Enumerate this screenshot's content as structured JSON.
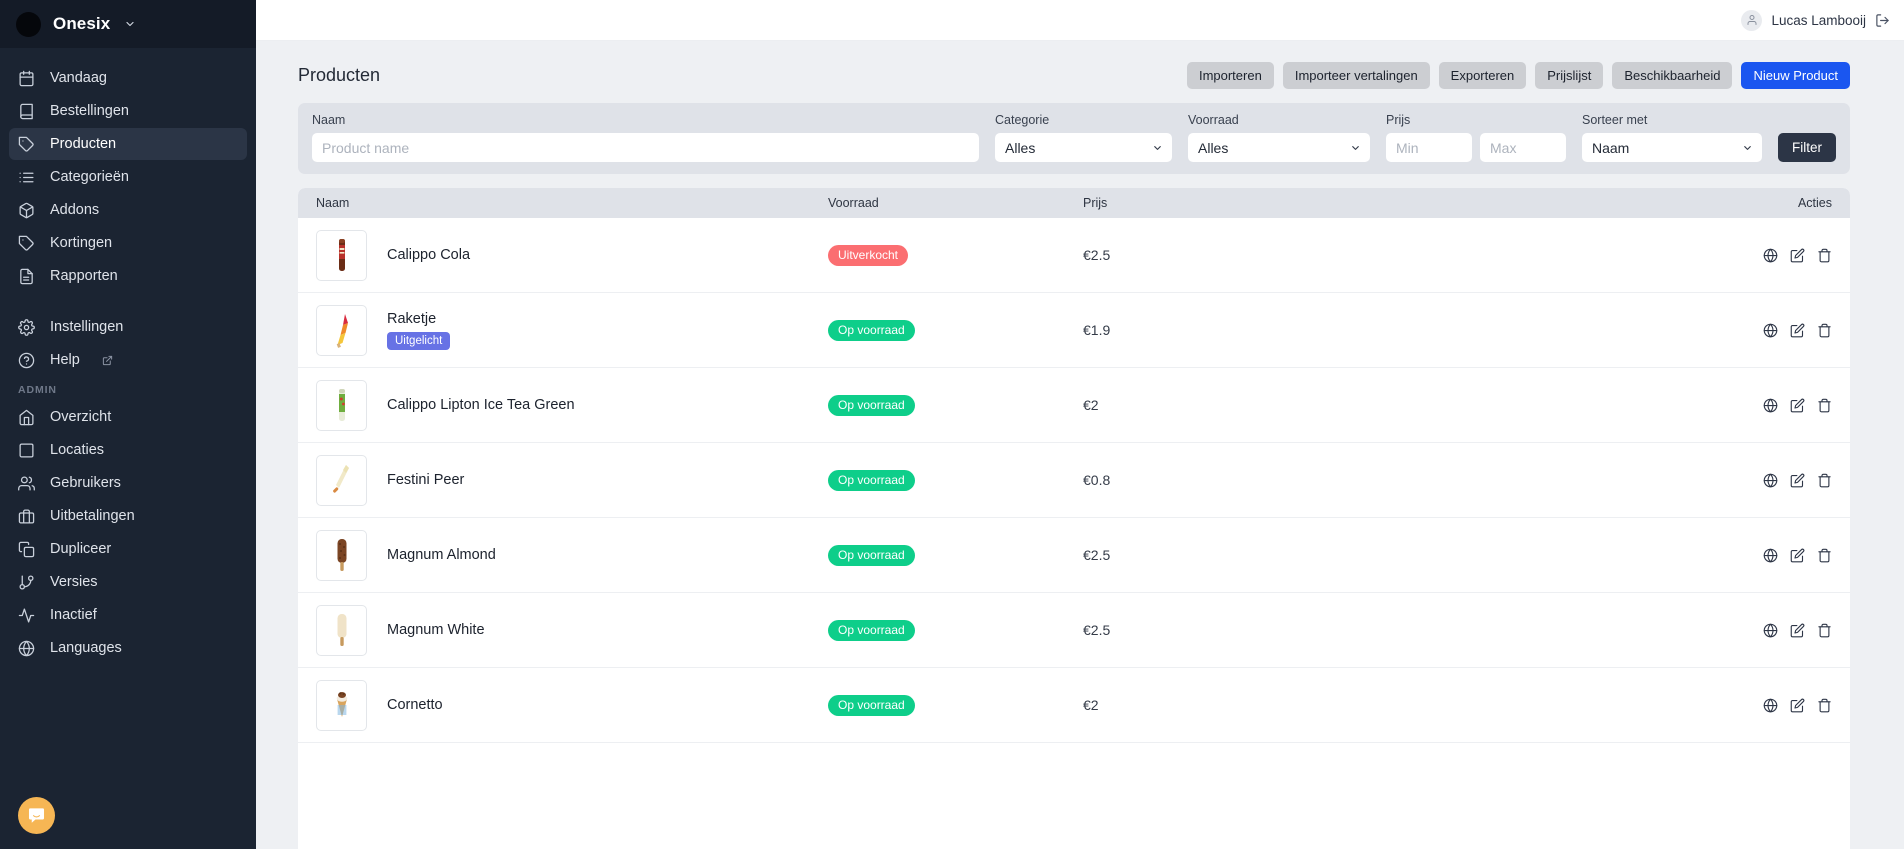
{
  "sidebar": {
    "brand": {
      "name": "Onesix",
      "logo_icon": "brand-avatar",
      "caret_icon": "chevron-down-icon"
    },
    "items": [
      {
        "label": "Vandaag",
        "icon": "calendar-icon",
        "active": false
      },
      {
        "label": "Bestellingen",
        "icon": "book-icon",
        "active": false
      },
      {
        "label": "Producten",
        "icon": "tag-icon",
        "active": true
      },
      {
        "label": "Categorieën",
        "icon": "list-icon",
        "active": false
      },
      {
        "label": "Addons",
        "icon": "box-icon",
        "active": false
      },
      {
        "label": "Kortingen",
        "icon": "tag-icon",
        "active": false
      },
      {
        "label": "Rapporten",
        "icon": "document-icon",
        "active": false
      }
    ],
    "secondary_items": [
      {
        "label": "Instellingen",
        "icon": "gear-icon",
        "active": false
      },
      {
        "label": "Help",
        "icon": "question-circle-icon",
        "active": false,
        "external": true
      }
    ],
    "admin_section_label": "ADMIN",
    "admin_items": [
      {
        "label": "Overzicht",
        "icon": "home-icon"
      },
      {
        "label": "Locaties",
        "icon": "square-icon"
      },
      {
        "label": "Gebruikers",
        "icon": "users-icon"
      },
      {
        "label": "Uitbetalingen",
        "icon": "briefcase-icon"
      },
      {
        "label": "Dupliceer",
        "icon": "copy-icon"
      },
      {
        "label": "Versies",
        "icon": "branch-icon"
      },
      {
        "label": "Inactief",
        "icon": "activity-icon"
      },
      {
        "label": "Languages",
        "icon": "globe-icon"
      }
    ],
    "chat_widget": {
      "icon": "chat-bubble-icon",
      "color": "#f6b654"
    }
  },
  "topbar": {
    "user_name": "Lucas Lambooij",
    "avatar_icon": "user-icon",
    "logout_icon": "logout-icon"
  },
  "page": {
    "title": "Producten",
    "buttons": [
      {
        "label": "Importeren",
        "style": "grey"
      },
      {
        "label": "Importeer vertalingen",
        "style": "grey"
      },
      {
        "label": "Exporteren",
        "style": "grey"
      },
      {
        "label": "Prijslijst",
        "style": "grey"
      },
      {
        "label": "Beschikbaarheid",
        "style": "grey"
      },
      {
        "label": "Nieuw Product",
        "style": "primary"
      }
    ]
  },
  "filters": {
    "name": {
      "label": "Naam",
      "value": "",
      "placeholder": "Product name"
    },
    "categorie": {
      "label": "Categorie",
      "value": "Alles",
      "options": [
        "Alles"
      ]
    },
    "voorraad": {
      "label": "Voorraad",
      "value": "Alles",
      "options": [
        "Alles"
      ]
    },
    "prijs": {
      "label": "Prijs",
      "min": {
        "value": "",
        "placeholder": "Min"
      },
      "max": {
        "value": "",
        "placeholder": "Max"
      }
    },
    "sorteer": {
      "label": "Sorteer met",
      "value": "Naam",
      "options": [
        "Naam"
      ]
    },
    "filter_button": "Filter"
  },
  "table": {
    "columns": [
      "Naam",
      "Voorraad",
      "Prijs",
      "Acties"
    ],
    "row_action_icons": [
      "globe-icon",
      "edit-icon",
      "trash-icon"
    ],
    "rows": [
      {
        "name": "Calippo Cola",
        "thumb": "calippo-cola",
        "badge": "Uitverkocht",
        "badge_color": "#fb6e71",
        "price": "€2.5",
        "featured": null
      },
      {
        "name": "Raketje",
        "thumb": "raketje",
        "badge": "Op voorraad",
        "badge_color": "#0ece8a",
        "price": "€1.9",
        "featured": "Uitgelicht"
      },
      {
        "name": "Calippo Lipton Ice Tea Green",
        "thumb": "calippo-green",
        "badge": "Op voorraad",
        "badge_color": "#0ece8a",
        "price": "€2",
        "featured": null
      },
      {
        "name": "Festini Peer",
        "thumb": "festini-peer",
        "badge": "Op voorraad",
        "badge_color": "#0ece8a",
        "price": "€0.8",
        "featured": null
      },
      {
        "name": "Magnum Almond",
        "thumb": "magnum-almond",
        "badge": "Op voorraad",
        "badge_color": "#0ece8a",
        "price": "€2.5",
        "featured": null
      },
      {
        "name": "Magnum White",
        "thumb": "magnum-white",
        "badge": "Op voorraad",
        "badge_color": "#0ece8a",
        "price": "€2.5",
        "featured": null
      },
      {
        "name": "Cornetto",
        "thumb": "cornetto",
        "badge": "Op voorraad",
        "badge_color": "#0ece8a",
        "price": "€2",
        "featured": null
      }
    ]
  },
  "colors": {
    "sidebar_bg": "#1b2432",
    "accent_primary": "#1a56f0",
    "badge_in_stock": "#0ece8a",
    "badge_out_of_stock": "#fb6e71",
    "badge_featured": "#6772e5",
    "filter_button": "#2c3546"
  }
}
